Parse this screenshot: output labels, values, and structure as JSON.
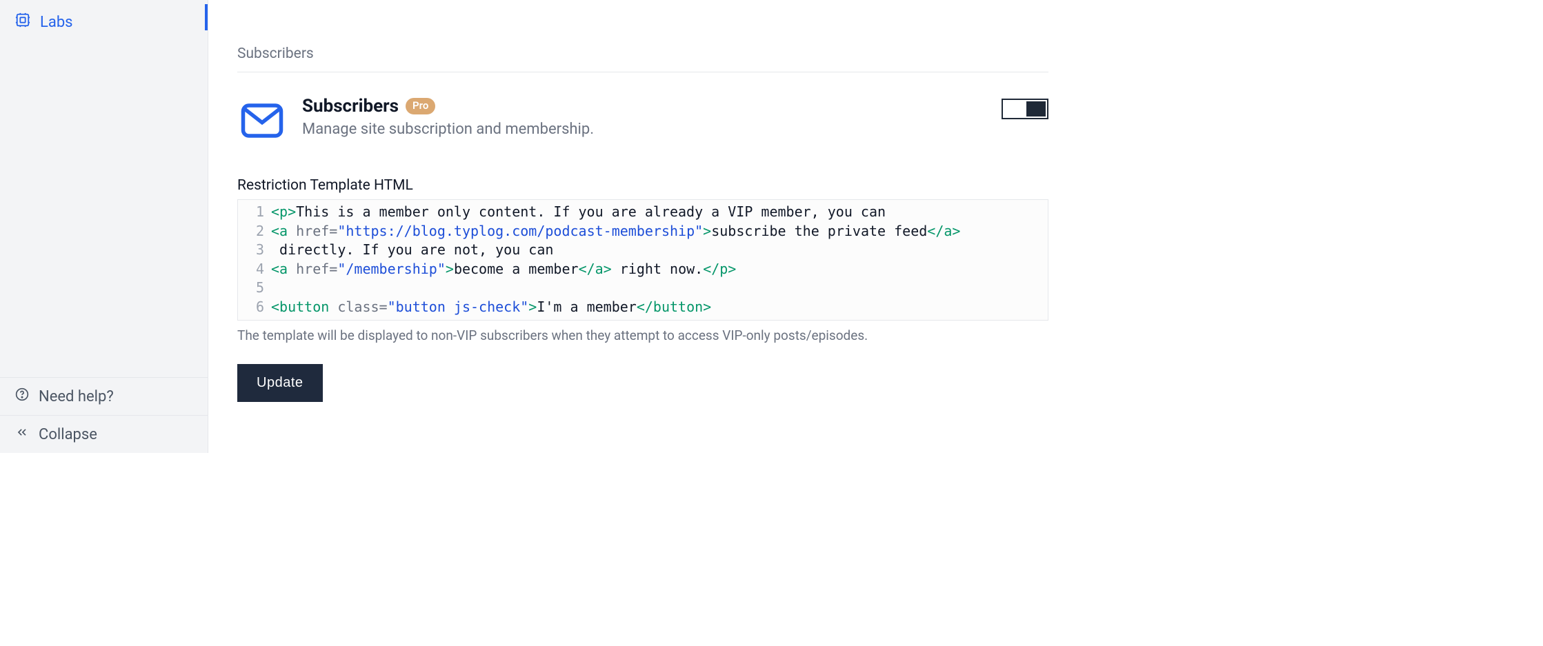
{
  "sidebar": {
    "labs_label": "Labs",
    "help_label": "Need help?",
    "collapse_label": "Collapse"
  },
  "section": {
    "header": "Subscribers"
  },
  "feature": {
    "title": "Subscribers",
    "badge": "Pro",
    "description": "Manage site subscription and membership.",
    "toggle_on": true
  },
  "template": {
    "label": "Restriction Template HTML",
    "lines": [
      {
        "n": "1",
        "segments": [
          {
            "t": "tag",
            "v": "<p>"
          },
          {
            "t": "plain",
            "v": "This is a member only content. If you are already a VIP member, you can"
          }
        ]
      },
      {
        "n": "2",
        "segments": [
          {
            "t": "tag",
            "v": "<a "
          },
          {
            "t": "attr-name",
            "v": "href"
          },
          {
            "t": "attr-eq",
            "v": "="
          },
          {
            "t": "attr-value",
            "v": "\"https://blog.typlog.com/podcast-membership\""
          },
          {
            "t": "tag",
            "v": ">"
          },
          {
            "t": "plain",
            "v": "subscribe the private feed"
          },
          {
            "t": "tag",
            "v": "</a>"
          }
        ]
      },
      {
        "n": "3",
        "segments": [
          {
            "t": "plain",
            "v": " directly. If you are not, you can"
          }
        ]
      },
      {
        "n": "4",
        "segments": [
          {
            "t": "tag",
            "v": "<a "
          },
          {
            "t": "attr-name",
            "v": "href"
          },
          {
            "t": "attr-eq",
            "v": "="
          },
          {
            "t": "attr-value",
            "v": "\"/membership\""
          },
          {
            "t": "tag",
            "v": ">"
          },
          {
            "t": "plain",
            "v": "become a member"
          },
          {
            "t": "tag",
            "v": "</a>"
          },
          {
            "t": "plain",
            "v": " right now."
          },
          {
            "t": "tag",
            "v": "</p>"
          }
        ]
      },
      {
        "n": "5",
        "segments": []
      },
      {
        "n": "6",
        "segments": [
          {
            "t": "tag",
            "v": "<button "
          },
          {
            "t": "attr-name",
            "v": "class"
          },
          {
            "t": "attr-eq",
            "v": "="
          },
          {
            "t": "attr-value",
            "v": "\"button js-check\""
          },
          {
            "t": "tag",
            "v": ">"
          },
          {
            "t": "plain",
            "v": "I'm a member"
          },
          {
            "t": "tag",
            "v": "</button>"
          }
        ]
      }
    ],
    "help": "The template will be displayed to non-VIP subscribers when they attempt to access VIP-only posts/episodes."
  },
  "actions": {
    "update_label": "Update"
  }
}
